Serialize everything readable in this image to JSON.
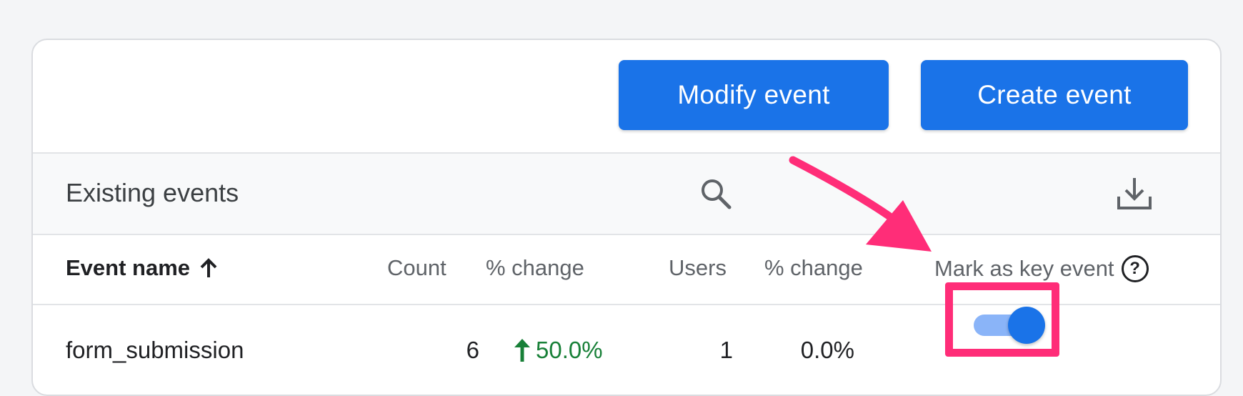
{
  "actions": {
    "modify_label": "Modify event",
    "create_label": "Create event"
  },
  "toolbar": {
    "title": "Existing events",
    "search_icon": "search-icon",
    "download_icon": "download-icon"
  },
  "table": {
    "headers": {
      "event_name": "Event name",
      "count": "Count",
      "count_change": "% change",
      "users": "Users",
      "users_change": "% change",
      "mark_key_event": "Mark as key event",
      "help_glyph": "?"
    },
    "rows": [
      {
        "event_name": "form_submission",
        "count": "6",
        "count_change": "50.0%",
        "users": "1",
        "users_change": "0.0%",
        "key_event": true
      }
    ]
  },
  "colors": {
    "primary": "#1a73e8",
    "positive": "#188038",
    "annotation": "#ff2d78",
    "toggle_track": "#8ab4f8"
  }
}
